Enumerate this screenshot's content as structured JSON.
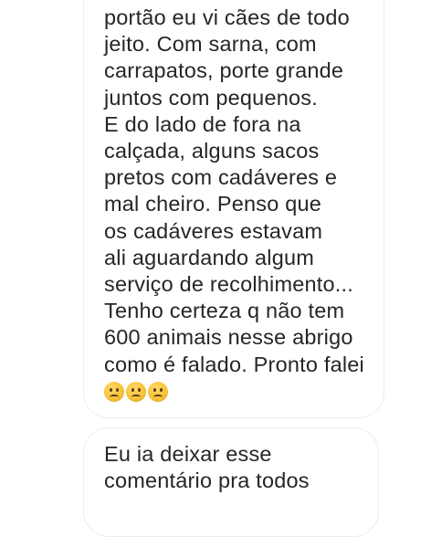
{
  "messages": [
    {
      "text": "portão eu vi cães de todo\njeito. Com sarna, com\ncarrapatos, porte grande\njuntos com pequenos.\nE do lado de fora na\ncalçada, alguns sacos\npretos com cadáveres e\nmal cheiro. Penso que\nos cadáveres estavam\nali aguardando algum\nserviço de recolhimento...\nTenho certeza q não tem\n600 animais nesse abrigo\ncomo é falado. Pronto falei",
      "emojis": [
        "frowning-face",
        "frowning-face",
        "frowning-face"
      ]
    },
    {
      "text": "Eu ia deixar esse\ncomentário pra todos"
    }
  ],
  "colors": {
    "text": "#262626",
    "bubble_border": "#ececec",
    "background": "#ffffff"
  }
}
